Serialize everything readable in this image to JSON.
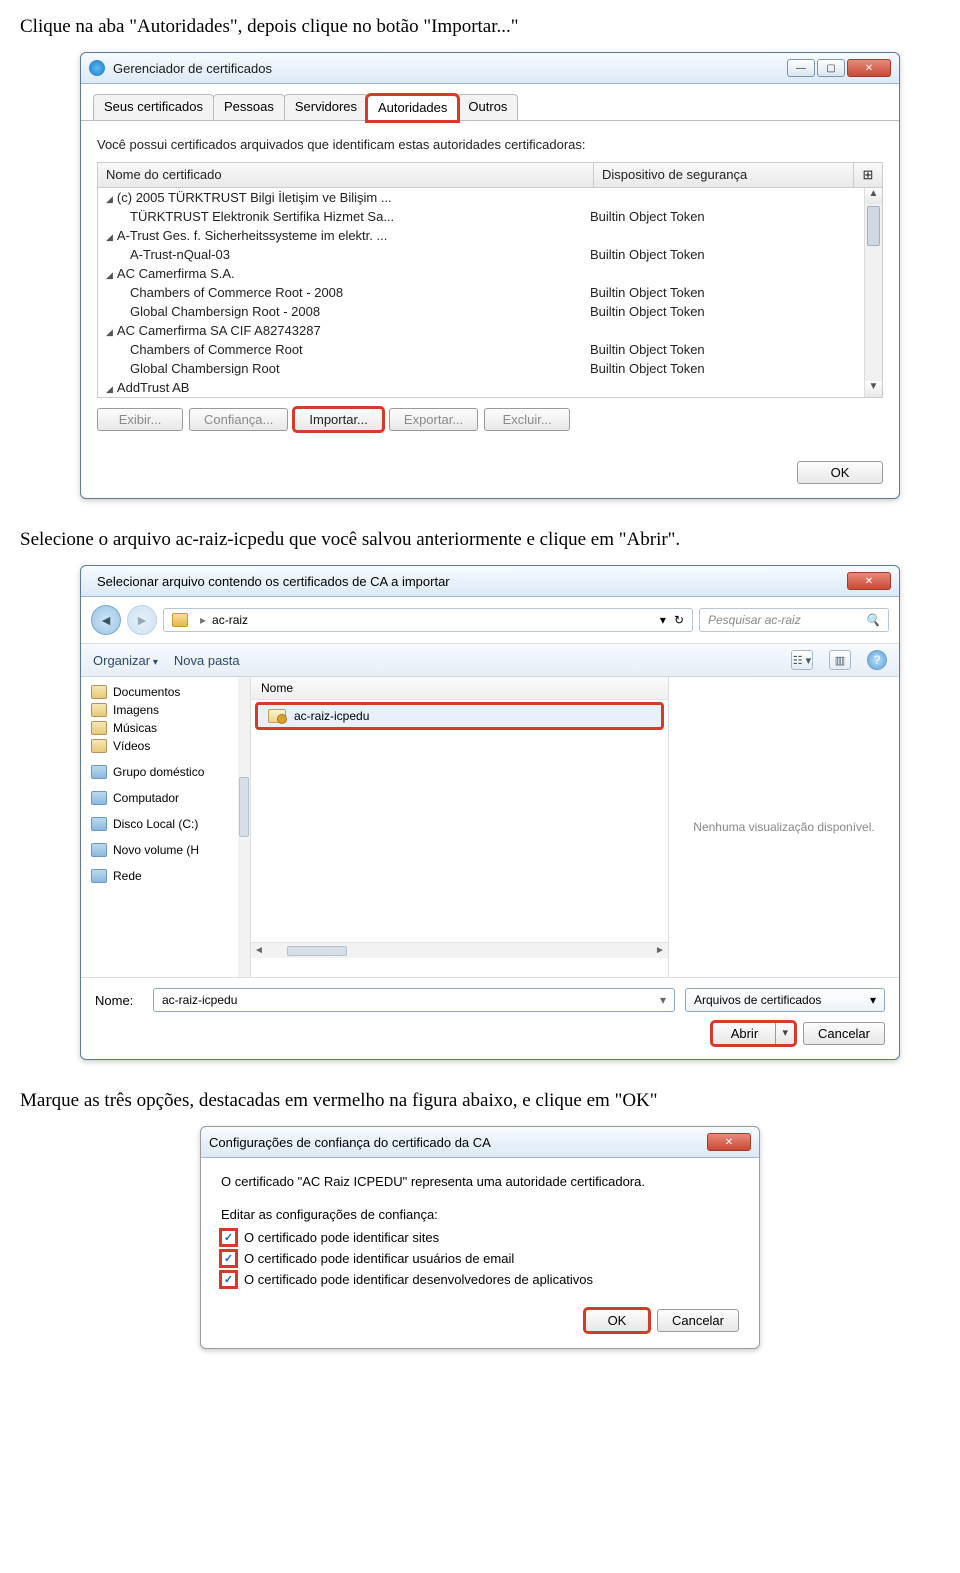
{
  "instructions": {
    "step1": "Clique na aba \"Autoridades\", depois clique no botão \"Importar...\"",
    "step2": "Selecione o arquivo ac-raiz-icpedu que você salvou anteriormente e clique em \"Abrir\".",
    "step3": "Marque as três opções, destacadas em vermelho na figura abaixo, e clique em \"OK\""
  },
  "certmgr": {
    "title": "Gerenciador de certificados",
    "tabs": [
      "Seus certificados",
      "Pessoas",
      "Servidores",
      "Autoridades",
      "Outros"
    ],
    "active_tab_index": 3,
    "hint": "Você possui certificados arquivados que identificam estas autoridades certificadoras:",
    "columns": {
      "name": "Nome do certificado",
      "device": "Dispositivo de segurança",
      "ctrl": "⊞"
    },
    "rows": [
      {
        "type": "group",
        "name": "(c) 2005 TÜRKTRUST Bilgi İletişim ve Bilişim ...",
        "device": ""
      },
      {
        "type": "child",
        "name": "TÜRKTRUST Elektronik Sertifika Hizmet Sa...",
        "device": "Builtin Object Token"
      },
      {
        "type": "group",
        "name": "A-Trust Ges. f. Sicherheitssysteme im elektr. ...",
        "device": ""
      },
      {
        "type": "child",
        "name": "A-Trust-nQual-03",
        "device": "Builtin Object Token"
      },
      {
        "type": "group",
        "name": "AC Camerfirma S.A.",
        "device": ""
      },
      {
        "type": "child",
        "name": "Chambers of Commerce Root - 2008",
        "device": "Builtin Object Token"
      },
      {
        "type": "child",
        "name": "Global Chambersign Root - 2008",
        "device": "Builtin Object Token"
      },
      {
        "type": "group",
        "name": "AC Camerfirma SA CIF A82743287",
        "device": ""
      },
      {
        "type": "child",
        "name": "Chambers of Commerce Root",
        "device": "Builtin Object Token"
      },
      {
        "type": "child",
        "name": "Global Chambersign Root",
        "device": "Builtin Object Token"
      },
      {
        "type": "group",
        "name": "AddTrust AB",
        "device": ""
      }
    ],
    "buttons": {
      "view": "Exibir...",
      "trust": "Confiança...",
      "import": "Importar...",
      "export": "Exportar...",
      "delete": "Excluir..."
    },
    "ok": "OK"
  },
  "filedlg": {
    "title": "Selecionar arquivo contendo os certificados de CA a importar",
    "breadcrumb": {
      "path": "ac-raiz",
      "refresh": "↻"
    },
    "search_placeholder": "Pesquisar ac-raiz",
    "toolbar": {
      "organize": "Organizar",
      "newfolder": "Nova pasta"
    },
    "sidebar": [
      {
        "label": "Documentos",
        "kind": "lib"
      },
      {
        "label": "Imagens",
        "kind": "lib"
      },
      {
        "label": "Músicas",
        "kind": "lib"
      },
      {
        "label": "Vídeos",
        "kind": "lib"
      },
      {
        "label": "Grupo doméstico",
        "kind": "grp"
      },
      {
        "label": "Computador",
        "kind": "grp"
      },
      {
        "label": "Disco Local (C:)",
        "kind": "drv"
      },
      {
        "label": "Novo volume (H",
        "kind": "drv"
      },
      {
        "label": "Rede",
        "kind": "grp"
      }
    ],
    "list_header": "Nome",
    "file_row": "ac-raiz-icpedu",
    "preview_text": "Nenhuma visualização disponível.",
    "name_label": "Nome:",
    "name_value": "ac-raiz-icpedu",
    "filter": "Arquivos de certificados",
    "open": "Abrir",
    "cancel": "Cancelar"
  },
  "trustdlg": {
    "title": "Configurações de confiança do certificado da CA",
    "intro": "O certificado \"AC Raiz ICPEDU\" representa uma autoridade certificadora.",
    "edit_label": "Editar as configurações de confiança:",
    "opts": [
      "O certificado pode identificar sites",
      "O certificado pode identificar usuários de email",
      "O certificado pode identificar desenvolvedores de aplicativos"
    ],
    "ok": "OK",
    "cancel": "Cancelar"
  }
}
